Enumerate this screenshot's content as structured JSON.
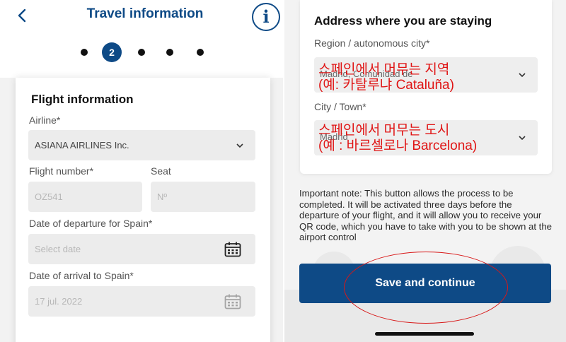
{
  "left": {
    "header": {
      "title": "Travel information",
      "back_icon": "chevron-left-icon",
      "info_icon": "info-icon"
    },
    "steps": {
      "active_label": "2"
    },
    "section_title": "Flight information",
    "airline": {
      "label": "Airline*",
      "value": "ASIANA AIRLINES Inc."
    },
    "flight_number": {
      "label": "Flight number*",
      "placeholder": "OZ541"
    },
    "seat": {
      "label": "Seat",
      "placeholder": "Nº"
    },
    "departure": {
      "label": "Date of departure for Spain*",
      "placeholder": "Select date"
    },
    "arrival": {
      "label": "Date of arrival to Spain*",
      "placeholder": "17 jul. 2022"
    }
  },
  "right": {
    "section_title": "Address where you are staying",
    "region": {
      "label": "Region / autonomous city*",
      "value": "Madrid, Comunidad de",
      "annotation_line1": "스페인에서 머무는 지역",
      "annotation_line2": "(예: 카탈루냐 Cataluña)"
    },
    "city": {
      "label": "City / Town*",
      "value": "Madrid",
      "annotation_line1": "스페인에서 머무는 도시",
      "annotation_line2": "(예 : 바르셀로나 Barcelona)"
    },
    "note": "Important note: This button allows the process to be completed. It will be activated three days before the departure of your flight, and it will allow you to receive your QR code, which you have to take with you to be shown at the airport control",
    "save_button": "Save and continue",
    "colors": {
      "brand": "#0e4a86",
      "annotation": "#e01414"
    }
  }
}
